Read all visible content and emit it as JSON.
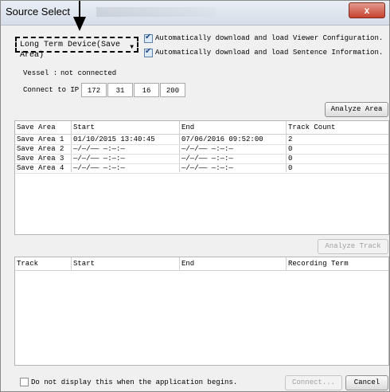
{
  "window": {
    "title": "Source Select",
    "close_label": "x"
  },
  "source": {
    "selected": "Long Term Device(Save Area)",
    "options_visible": [
      "Long Term Device(Save Area)"
    ]
  },
  "options": {
    "auto_viewer": {
      "label": "Automatically download and load Viewer Configuration.",
      "checked": true
    },
    "auto_sentence": {
      "label": "Automatically download and load Sentence Information.",
      "checked": true
    }
  },
  "vessel": {
    "label": "Vessel :",
    "status": "not connected"
  },
  "connect": {
    "label": "Connect to IP :",
    "ip": [
      "172",
      "31",
      "16",
      "200"
    ]
  },
  "buttons": {
    "analyze_area": "Analyze Area",
    "analyze_track": "Analyze Track",
    "connect": "Connect...",
    "cancel": "Cancel"
  },
  "save_table": {
    "headers": [
      "Save Area",
      "Start",
      "End",
      "Track Count"
    ],
    "rows": [
      [
        "Save Area 1",
        "01/10/2015 13:40:45",
        "07/06/2016 09:52:00",
        "2"
      ],
      [
        "Save Area 2",
        "—/—/—— —:—:—",
        "—/—/—— —:—:—",
        "0"
      ],
      [
        "Save Area 3",
        "—/—/—— —:—:—",
        "—/—/—— —:—:—",
        "0"
      ],
      [
        "Save Area 4",
        "—/—/—— —:—:—",
        "—/—/—— —:—:—",
        "0"
      ]
    ]
  },
  "track_table": {
    "headers": [
      "Track",
      "Start",
      "End",
      "Recording Term"
    ],
    "rows": []
  },
  "footer": {
    "no_display_label": "Do not display this when the application begins.",
    "checked": false
  },
  "colors": {
    "titlebar": "#dbe2ec",
    "close": "#c7432f",
    "check": "#1f4a86"
  }
}
